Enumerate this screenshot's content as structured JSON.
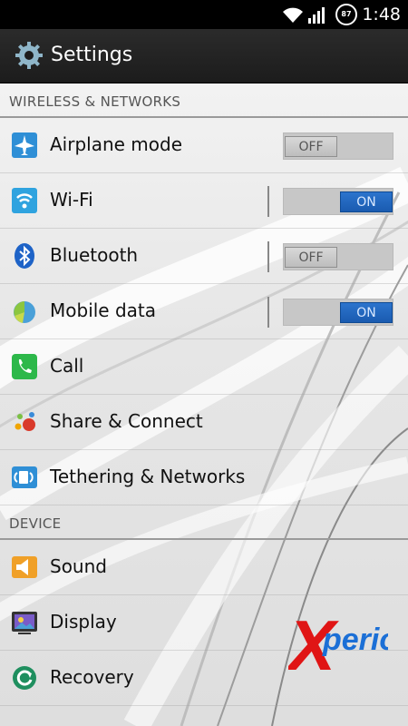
{
  "status": {
    "time": "1:48",
    "battery": "87"
  },
  "header": {
    "title": "Settings"
  },
  "sections": {
    "wireless": "WIRELESS & NETWORKS",
    "device": "DEVICE"
  },
  "items": {
    "airplane": {
      "label": "Airplane mode",
      "toggle": "OFF"
    },
    "wifi": {
      "label": "Wi-Fi",
      "toggle": "ON"
    },
    "bluetooth": {
      "label": "Bluetooth",
      "toggle": "OFF"
    },
    "mobile_data": {
      "label": "Mobile data",
      "toggle": "ON"
    },
    "call": {
      "label": "Call"
    },
    "share": {
      "label": "Share & Connect"
    },
    "tethering": {
      "label": "Tethering & Networks"
    },
    "sound": {
      "label": "Sound"
    },
    "display": {
      "label": "Display"
    },
    "recovery": {
      "label": "Recovery"
    }
  },
  "watermark": {
    "x": "X",
    "rest": "perion"
  },
  "colors": {
    "toggle_on": "#1a5bb0",
    "action_bar": "#1c1c1c"
  }
}
